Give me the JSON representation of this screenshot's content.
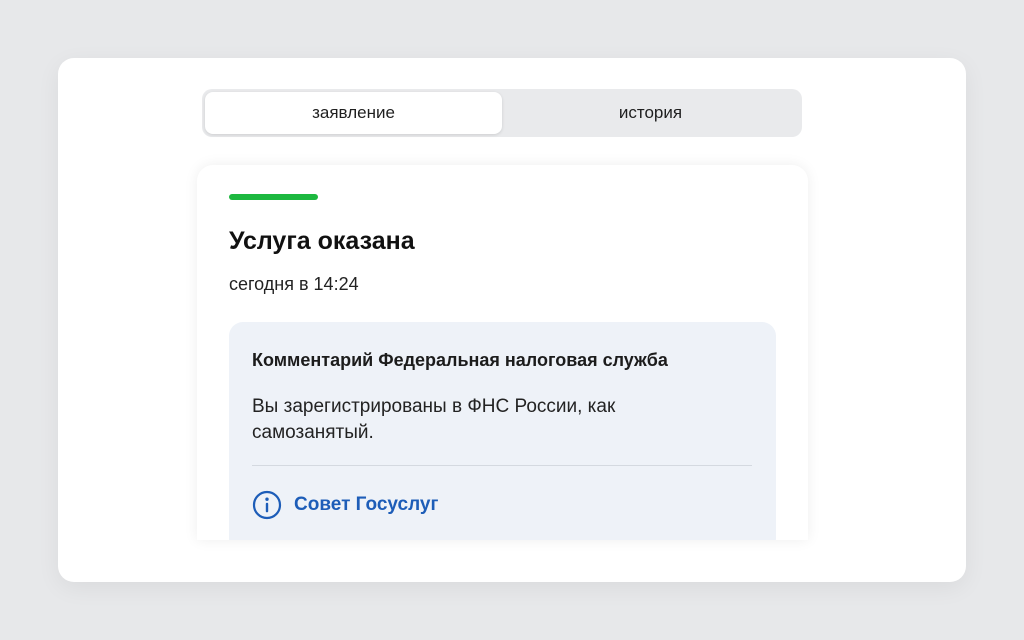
{
  "tabs": [
    {
      "label": "заявление",
      "active": true
    },
    {
      "label": "история",
      "active": false
    }
  ],
  "status": {
    "title": "Услуга оказана",
    "time": "сегодня в 14:24",
    "color": "#1db83f"
  },
  "comment": {
    "title": "Комментарий Федеральная налоговая служба",
    "text": "Вы зарегистрированы в ФНС России, как самозанятый.",
    "advice_label": "Совет Госуслуг",
    "advice_icon": "info-icon",
    "accent_color": "#1d5db8"
  }
}
